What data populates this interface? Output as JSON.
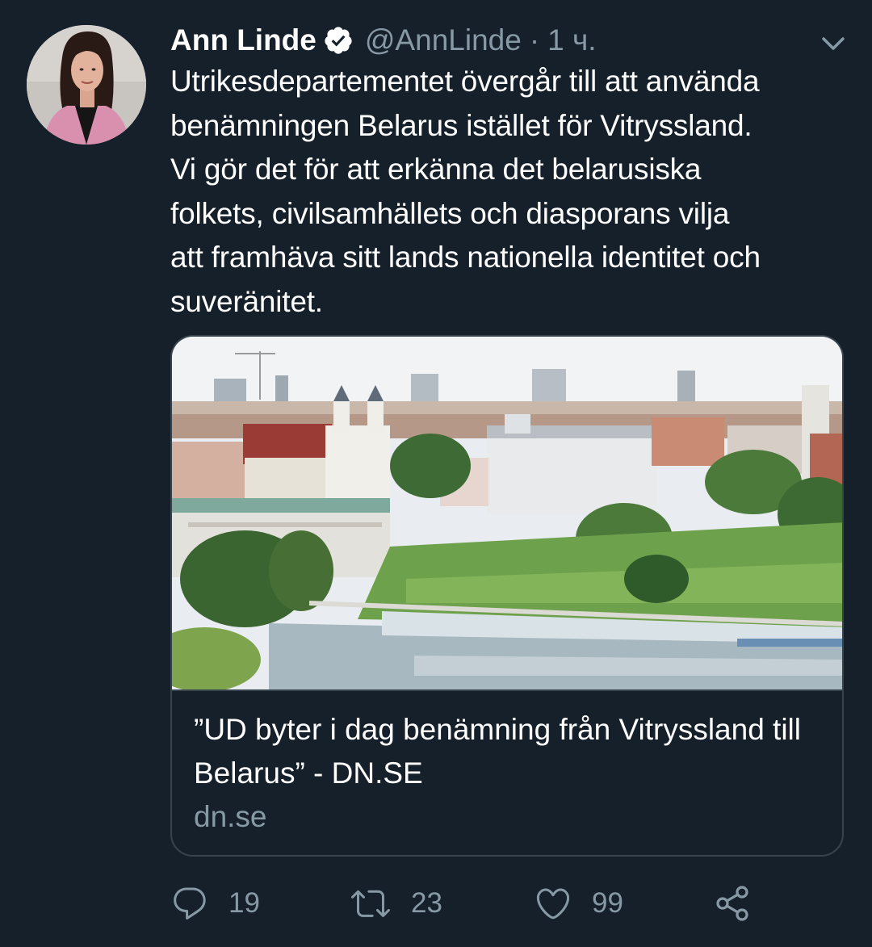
{
  "tweet": {
    "author_name": "Ann Linde",
    "handle": "@AnnLinde",
    "separator": "·",
    "time": "1 ч.",
    "text": "Utrikesdepartementet övergår till att använda\nbenämningen Belarus istället för Vitryssland.\nVi gör det för att erkänna det belarusiska\nfolkets, civilsamhällets och diasporans vilja\natt framhäva sitt lands nationella identitet och\nsuveränitet.",
    "card": {
      "title": "”UD byter i dag benämning från Vitryssland till Belarus” - DN.SE",
      "domain": "dn.se",
      "image_icon": "city-photo"
    },
    "actions": {
      "reply_count": "19",
      "retweet_count": "23",
      "like_count": "99"
    }
  },
  "icons": {
    "verified": "verified-badge-icon",
    "caret": "chevron-down-icon",
    "reply": "reply-icon",
    "retweet": "retweet-icon",
    "like": "heart-icon",
    "share": "share-icon"
  },
  "colors": {
    "background": "#15202b",
    "secondary_text": "#8899a6",
    "border": "#38444d",
    "primary_text": "#ffffff"
  }
}
